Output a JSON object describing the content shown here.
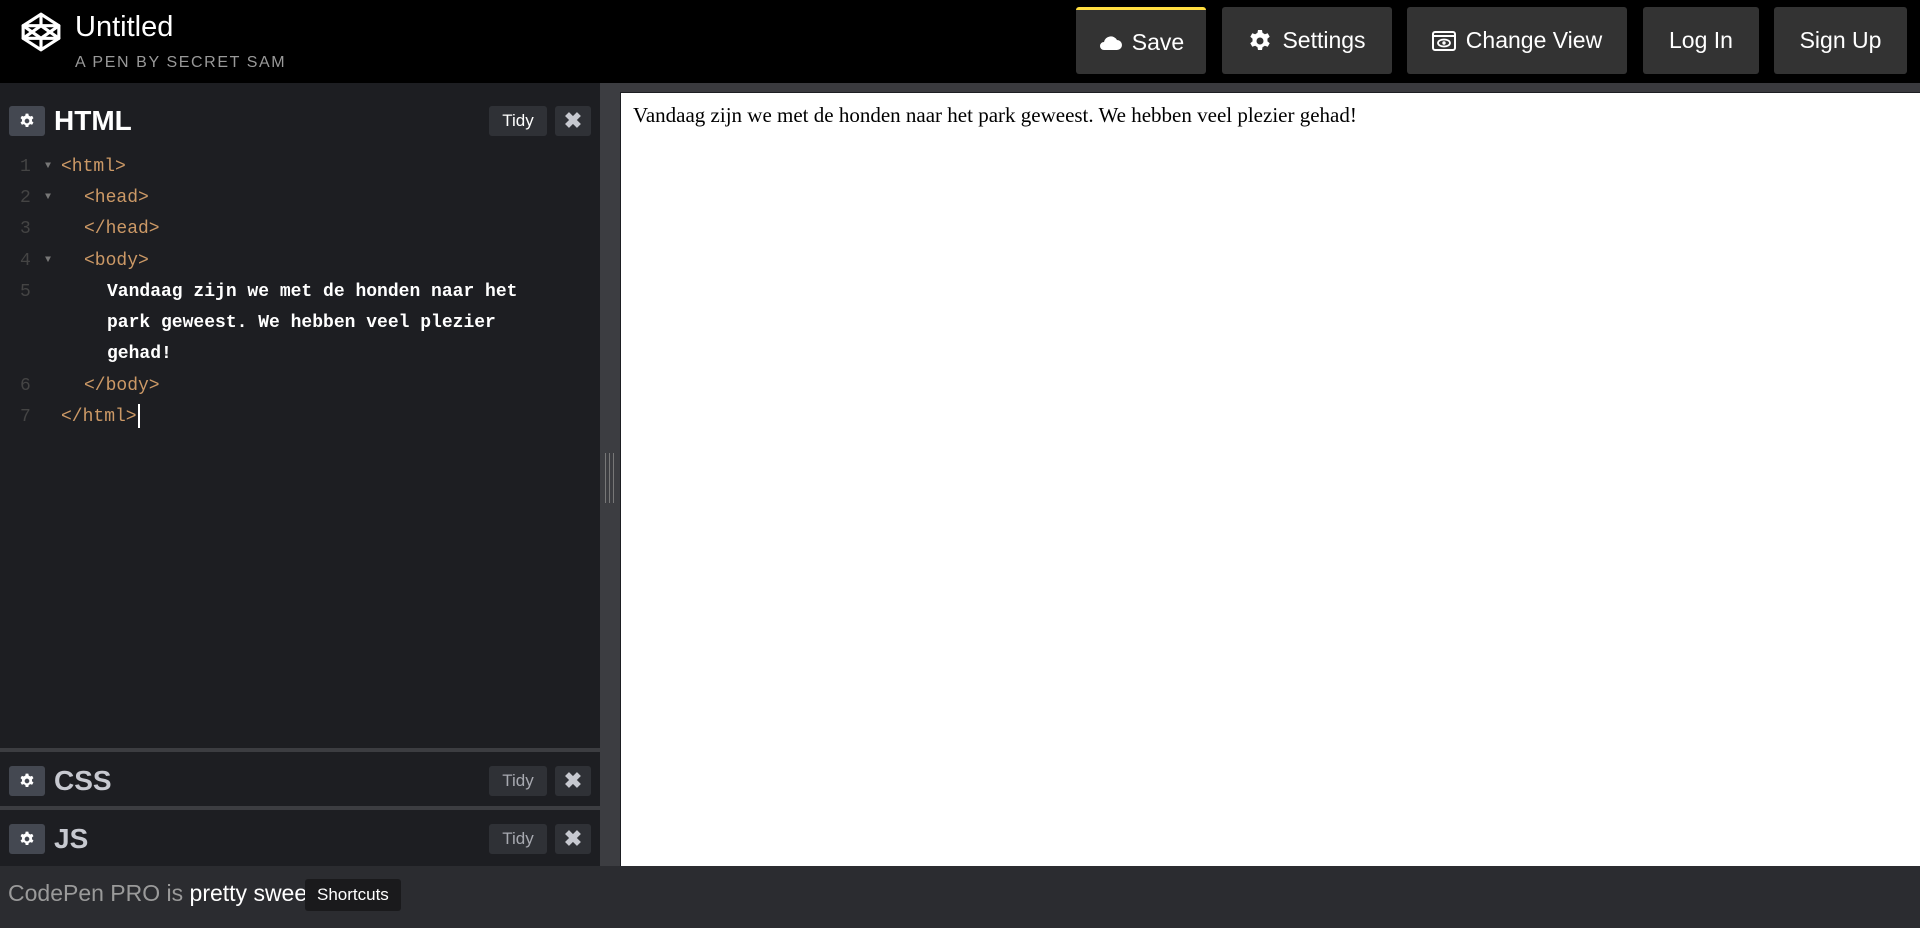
{
  "header": {
    "title": "Untitled",
    "subtitle": "A PEN BY SECRET SAM",
    "buttons": {
      "save": "Save",
      "settings": "Settings",
      "change_view": "Change View",
      "login": "Log In",
      "signup": "Sign Up"
    },
    "accent_color": "#ffdd40"
  },
  "editors": {
    "html": {
      "title": "HTML",
      "tidy": "Tidy",
      "close": "✖"
    },
    "css": {
      "title": "CSS",
      "tidy": "Tidy",
      "close": "✖"
    },
    "js": {
      "title": "JS",
      "tidy": "Tidy",
      "close": "✖"
    }
  },
  "code": {
    "lines": [
      {
        "num": "1",
        "text": "<html>"
      },
      {
        "num": "2",
        "text": "<head>"
      },
      {
        "num": "3",
        "text": "</head>"
      },
      {
        "num": "4",
        "text": "<body>"
      },
      {
        "num": "5",
        "text": "Vandaag zijn we met de honden naar het"
      },
      {
        "num": "",
        "text": "park geweest. We hebben veel plezier"
      },
      {
        "num": "",
        "text": "gehad!"
      },
      {
        "num": "6",
        "text": "</body>"
      },
      {
        "num": "7",
        "text": "</html>"
      }
    ]
  },
  "preview": {
    "text": "Vandaag zijn we met de honden naar het park geweest. We hebben veel plezier gehad!"
  },
  "footer": {
    "text_prefix": "CodePen PRO is ",
    "text_bold": "pretty sweet",
    "text_suffix": ".",
    "shortcuts": "Shortcuts"
  }
}
